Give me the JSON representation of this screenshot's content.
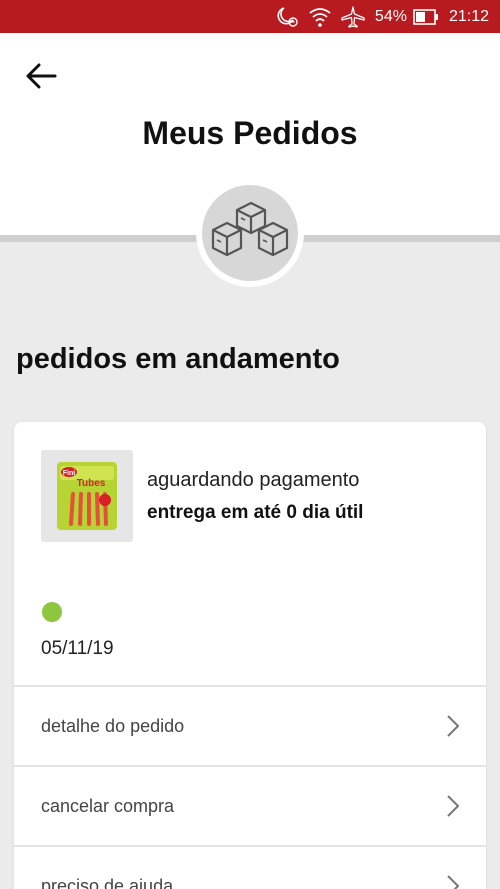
{
  "status_bar": {
    "battery": "54%",
    "time": "21:12",
    "icons": [
      "moon-alarm-icon",
      "wifi-icon",
      "airplane-icon",
      "battery-icon"
    ]
  },
  "header": {
    "back_icon": "arrow-left-icon",
    "title": "Meus Pedidos",
    "badge_icon": "boxes-icon"
  },
  "section": {
    "title": "pedidos em andamento"
  },
  "order": {
    "product_image": "product-thumbnail",
    "product_brand": "Fini",
    "product_name": "Tubes",
    "status": "aguardando pagamento",
    "delivery": "entrega em até 0 dia útil",
    "status_dot_color": "#8dc63f",
    "date": "05/11/19",
    "actions": [
      {
        "label": "detalhe do pedido",
        "icon": "chevron-right-icon"
      },
      {
        "label": "cancelar compra",
        "icon": "chevron-right-icon"
      },
      {
        "label": "preciso de ajuda",
        "icon": "chevron-right-icon"
      }
    ]
  },
  "colors": {
    "status_bar": "#b71a1f",
    "background": "#ebebeb",
    "card": "#ffffff"
  }
}
